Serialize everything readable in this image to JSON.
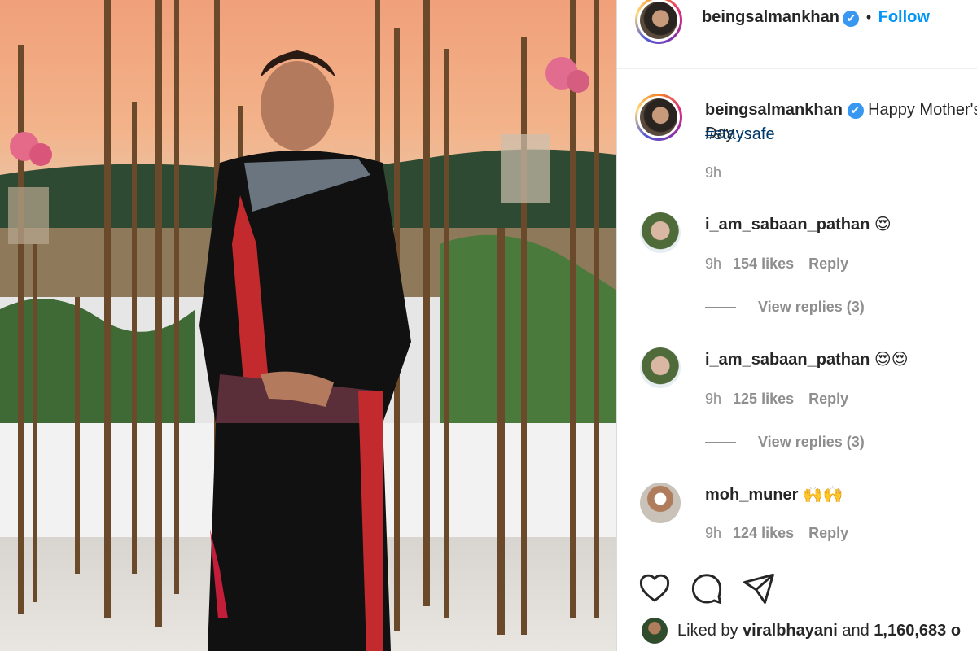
{
  "post": {
    "author": "beingsalmankhan",
    "verified_mark": "✔",
    "follow_separator": "•",
    "follow_label": "Follow",
    "caption_text": "Happy Mother's Day . .",
    "caption_hashtag": "#staysafe",
    "caption_time": "9h"
  },
  "comments": [
    {
      "username": "i_am_sabaan_pathan",
      "text": "😍",
      "time": "9h",
      "likes": "154 likes",
      "reply_label": "Reply",
      "view_replies": "View replies (3)"
    },
    {
      "username": "i_am_sabaan_pathan",
      "text": "😍😍",
      "time": "9h",
      "likes": "125 likes",
      "reply_label": "Reply",
      "view_replies": "View replies (3)"
    },
    {
      "username": "moh_muner",
      "text": "🙌🙌",
      "time": "9h",
      "likes": "124 likes",
      "reply_label": "Reply"
    }
  ],
  "liked_by": {
    "prefix": "Liked by",
    "user": "viralbhayani",
    "conjunction": "and",
    "count": "1,160,683 o"
  },
  "icons": [
    "heart-icon",
    "comment-icon",
    "share-icon"
  ],
  "colors": {
    "link": "#0095f6",
    "text": "#262626",
    "muted": "#8e8e8e",
    "hashtag": "#00376b"
  }
}
